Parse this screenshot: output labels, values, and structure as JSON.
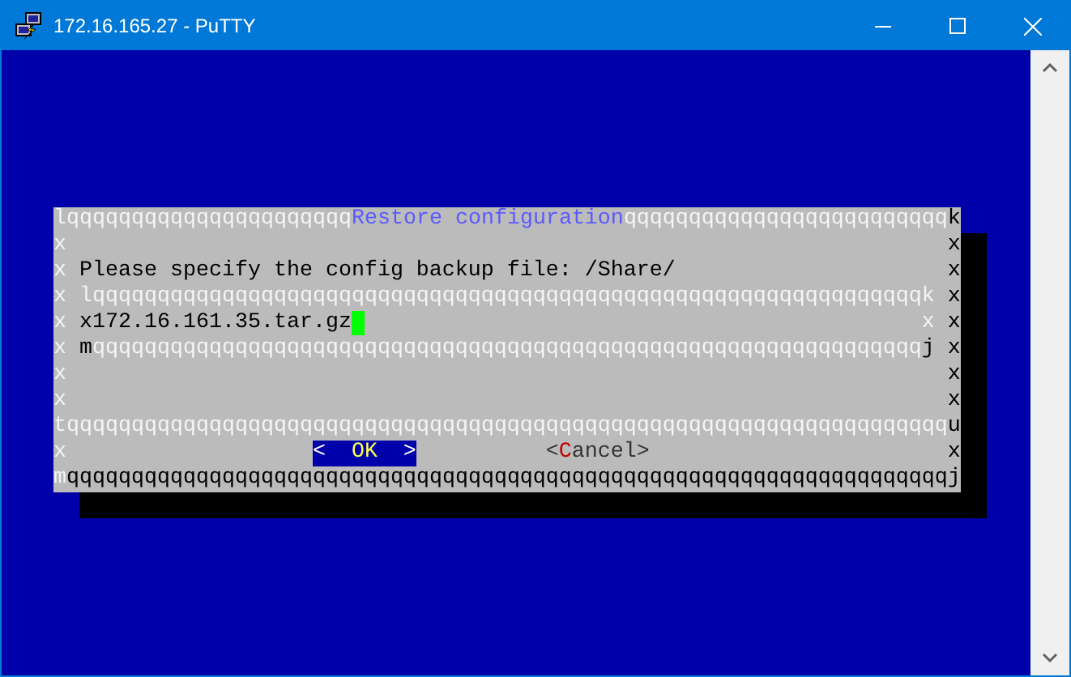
{
  "window": {
    "title": "172.16.165.27 - PuTTY"
  },
  "dialog": {
    "rows": [
      {
        "kind": "rule",
        "segments": [
          {
            "kind": "light",
            "text": "lqqqqqqqqqqqqqqqqqqqqqq"
          },
          {
            "kind": "title",
            "text": "Restore configuration"
          },
          {
            "kind": "light",
            "text": "qqqqqqqqqqqqqqqqqqqqqqqqq"
          },
          {
            "kind": "dark",
            "text": "k"
          }
        ]
      },
      {
        "kind": "side",
        "left": "x",
        "right": "x",
        "segments": []
      },
      {
        "kind": "side",
        "left": "x",
        "right": "x",
        "segments": [
          {
            "kind": "prompt",
            "text": "Please specify the config backup file: /Share/"
          }
        ]
      },
      {
        "kind": "side",
        "left": "x",
        "right": "x",
        "segments": [
          {
            "kind": "light",
            "text": "lqqqqqqqqqqqqqqqqqqqqqqqqqqqqqqqqqqqqqqqqqqqqqqqqqqqqqqqqqqqqqqqqk"
          }
        ]
      },
      {
        "kind": "field",
        "left": "x",
        "right": "x",
        "segments": [
          {
            "kind": "dark",
            "text": "x"
          },
          {
            "kind": "value",
            "text": "172.16.161.35.tar.gz"
          },
          {
            "kind": "light",
            "text": "x"
          }
        ]
      },
      {
        "kind": "side",
        "left": "x",
        "right": "x",
        "segments": [
          {
            "kind": "dark",
            "text": "m"
          },
          {
            "kind": "light",
            "text": "qqqqqqqqqqqqqqqqqqqqqqqqqqqqqqqqqqqqqqqqqqqqqqqqqqqqqqqqqqqqqqqq"
          },
          {
            "kind": "dark",
            "text": "j"
          }
        ]
      },
      {
        "kind": "side",
        "left": "x",
        "right": "x",
        "segments": []
      },
      {
        "kind": "side",
        "left": "x",
        "right": "x",
        "segments": []
      },
      {
        "kind": "rule",
        "segments": [
          {
            "kind": "light",
            "text": "tqqqqqqqqqqqqqqqqqqqqqqqqqqqqqqqqqqqqqqqqqqqqqqqqqqqqqqqqqqqqqqqqqqqq"
          },
          {
            "kind": "dark",
            "text": "u"
          }
        ]
      },
      {
        "kind": "buttons",
        "left": "x",
        "right": "x",
        "buttons": [
          {
            "open": "<  ",
            "hotkey": "O",
            "rest": "K",
            "close": "  >",
            "selected": true
          },
          {
            "open": "<",
            "hotkey": "C",
            "rest": "ancel",
            "close": ">",
            "selected": false
          }
        ]
      },
      {
        "kind": "rule",
        "segments": [
          {
            "kind": "light",
            "text": "m"
          },
          {
            "kind": "dark",
            "text": "qqqqqqqqqqqqqqqqqqqqqqqqqqqqqqqqqqqqqqqqqqqqqqqqqqqqqqqqqqqqqqqqqqqqj"
          }
        ]
      }
    ]
  }
}
